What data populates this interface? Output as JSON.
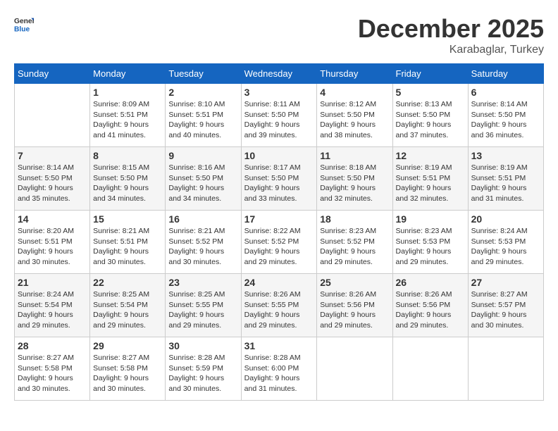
{
  "header": {
    "logo_general": "General",
    "logo_blue": "Blue",
    "month_title": "December 2025",
    "location": "Karabaglar, Turkey"
  },
  "columns": [
    "Sunday",
    "Monday",
    "Tuesday",
    "Wednesday",
    "Thursday",
    "Friday",
    "Saturday"
  ],
  "weeks": [
    [
      {
        "day": "",
        "sunrise": "",
        "sunset": "",
        "daylight": ""
      },
      {
        "day": "1",
        "sunrise": "Sunrise: 8:09 AM",
        "sunset": "Sunset: 5:51 PM",
        "daylight": "Daylight: 9 hours and 41 minutes."
      },
      {
        "day": "2",
        "sunrise": "Sunrise: 8:10 AM",
        "sunset": "Sunset: 5:51 PM",
        "daylight": "Daylight: 9 hours and 40 minutes."
      },
      {
        "day": "3",
        "sunrise": "Sunrise: 8:11 AM",
        "sunset": "Sunset: 5:50 PM",
        "daylight": "Daylight: 9 hours and 39 minutes."
      },
      {
        "day": "4",
        "sunrise": "Sunrise: 8:12 AM",
        "sunset": "Sunset: 5:50 PM",
        "daylight": "Daylight: 9 hours and 38 minutes."
      },
      {
        "day": "5",
        "sunrise": "Sunrise: 8:13 AM",
        "sunset": "Sunset: 5:50 PM",
        "daylight": "Daylight: 9 hours and 37 minutes."
      },
      {
        "day": "6",
        "sunrise": "Sunrise: 8:14 AM",
        "sunset": "Sunset: 5:50 PM",
        "daylight": "Daylight: 9 hours and 36 minutes."
      }
    ],
    [
      {
        "day": "7",
        "sunrise": "Sunrise: 8:14 AM",
        "sunset": "Sunset: 5:50 PM",
        "daylight": "Daylight: 9 hours and 35 minutes."
      },
      {
        "day": "8",
        "sunrise": "Sunrise: 8:15 AM",
        "sunset": "Sunset: 5:50 PM",
        "daylight": "Daylight: 9 hours and 34 minutes."
      },
      {
        "day": "9",
        "sunrise": "Sunrise: 8:16 AM",
        "sunset": "Sunset: 5:50 PM",
        "daylight": "Daylight: 9 hours and 34 minutes."
      },
      {
        "day": "10",
        "sunrise": "Sunrise: 8:17 AM",
        "sunset": "Sunset: 5:50 PM",
        "daylight": "Daylight: 9 hours and 33 minutes."
      },
      {
        "day": "11",
        "sunrise": "Sunrise: 8:18 AM",
        "sunset": "Sunset: 5:50 PM",
        "daylight": "Daylight: 9 hours and 32 minutes."
      },
      {
        "day": "12",
        "sunrise": "Sunrise: 8:19 AM",
        "sunset": "Sunset: 5:51 PM",
        "daylight": "Daylight: 9 hours and 32 minutes."
      },
      {
        "day": "13",
        "sunrise": "Sunrise: 8:19 AM",
        "sunset": "Sunset: 5:51 PM",
        "daylight": "Daylight: 9 hours and 31 minutes."
      }
    ],
    [
      {
        "day": "14",
        "sunrise": "Sunrise: 8:20 AM",
        "sunset": "Sunset: 5:51 PM",
        "daylight": "Daylight: 9 hours and 30 minutes."
      },
      {
        "day": "15",
        "sunrise": "Sunrise: 8:21 AM",
        "sunset": "Sunset: 5:51 PM",
        "daylight": "Daylight: 9 hours and 30 minutes."
      },
      {
        "day": "16",
        "sunrise": "Sunrise: 8:21 AM",
        "sunset": "Sunset: 5:52 PM",
        "daylight": "Daylight: 9 hours and 30 minutes."
      },
      {
        "day": "17",
        "sunrise": "Sunrise: 8:22 AM",
        "sunset": "Sunset: 5:52 PM",
        "daylight": "Daylight: 9 hours and 29 minutes."
      },
      {
        "day": "18",
        "sunrise": "Sunrise: 8:23 AM",
        "sunset": "Sunset: 5:52 PM",
        "daylight": "Daylight: 9 hours and 29 minutes."
      },
      {
        "day": "19",
        "sunrise": "Sunrise: 8:23 AM",
        "sunset": "Sunset: 5:53 PM",
        "daylight": "Daylight: 9 hours and 29 minutes."
      },
      {
        "day": "20",
        "sunrise": "Sunrise: 8:24 AM",
        "sunset": "Sunset: 5:53 PM",
        "daylight": "Daylight: 9 hours and 29 minutes."
      }
    ],
    [
      {
        "day": "21",
        "sunrise": "Sunrise: 8:24 AM",
        "sunset": "Sunset: 5:54 PM",
        "daylight": "Daylight: 9 hours and 29 minutes."
      },
      {
        "day": "22",
        "sunrise": "Sunrise: 8:25 AM",
        "sunset": "Sunset: 5:54 PM",
        "daylight": "Daylight: 9 hours and 29 minutes."
      },
      {
        "day": "23",
        "sunrise": "Sunrise: 8:25 AM",
        "sunset": "Sunset: 5:55 PM",
        "daylight": "Daylight: 9 hours and 29 minutes."
      },
      {
        "day": "24",
        "sunrise": "Sunrise: 8:26 AM",
        "sunset": "Sunset: 5:55 PM",
        "daylight": "Daylight: 9 hours and 29 minutes."
      },
      {
        "day": "25",
        "sunrise": "Sunrise: 8:26 AM",
        "sunset": "Sunset: 5:56 PM",
        "daylight": "Daylight: 9 hours and 29 minutes."
      },
      {
        "day": "26",
        "sunrise": "Sunrise: 8:26 AM",
        "sunset": "Sunset: 5:56 PM",
        "daylight": "Daylight: 9 hours and 29 minutes."
      },
      {
        "day": "27",
        "sunrise": "Sunrise: 8:27 AM",
        "sunset": "Sunset: 5:57 PM",
        "daylight": "Daylight: 9 hours and 30 minutes."
      }
    ],
    [
      {
        "day": "28",
        "sunrise": "Sunrise: 8:27 AM",
        "sunset": "Sunset: 5:58 PM",
        "daylight": "Daylight: 9 hours and 30 minutes."
      },
      {
        "day": "29",
        "sunrise": "Sunrise: 8:27 AM",
        "sunset": "Sunset: 5:58 PM",
        "daylight": "Daylight: 9 hours and 30 minutes."
      },
      {
        "day": "30",
        "sunrise": "Sunrise: 8:28 AM",
        "sunset": "Sunset: 5:59 PM",
        "daylight": "Daylight: 9 hours and 30 minutes."
      },
      {
        "day": "31",
        "sunrise": "Sunrise: 8:28 AM",
        "sunset": "Sunset: 6:00 PM",
        "daylight": "Daylight: 9 hours and 31 minutes."
      },
      {
        "day": "",
        "sunrise": "",
        "sunset": "",
        "daylight": ""
      },
      {
        "day": "",
        "sunrise": "",
        "sunset": "",
        "daylight": ""
      },
      {
        "day": "",
        "sunrise": "",
        "sunset": "",
        "daylight": ""
      }
    ]
  ]
}
